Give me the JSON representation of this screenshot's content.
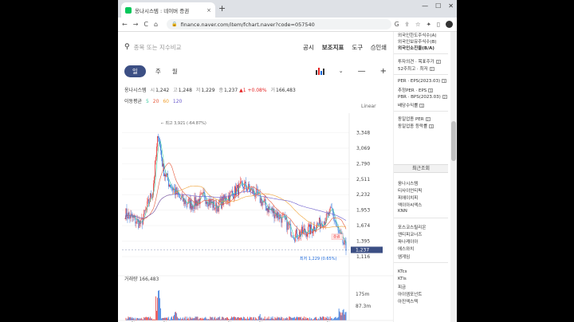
{
  "browser": {
    "tab_title": "옹나시스템 : 네이버 증권",
    "tab_close": "×",
    "new_tab": "+",
    "window_controls": [
      "—",
      "☐",
      "✕"
    ],
    "url": "finance.naver.com/item/fchart.naver?code=057540",
    "nav": [
      "←",
      "→",
      "C",
      "⌂"
    ],
    "ext_icons": [
      "G",
      "⇪",
      "☆",
      "✦",
      "▯"
    ]
  },
  "toolbar": {
    "search_placeholder": "종목 또는 지수비교",
    "menu": [
      "공시",
      "보조지표",
      "도구"
    ],
    "print": "인쇄"
  },
  "period": {
    "active": "일",
    "items": [
      "주",
      "월"
    ],
    "minus": "—",
    "plus": "+"
  },
  "info": {
    "name": "옹나시스템",
    "open_label": "시",
    "open": "1,242",
    "high_label": "고",
    "high": "1,248",
    "low_label": "저",
    "low": "1,229",
    "close_label": "종",
    "close": "1,237",
    "change": "▲1",
    "change_pct": "+0.08%",
    "vol_label": "거",
    "volume": "166,483"
  },
  "ma": {
    "label": "이동평균",
    "periods": [
      "5",
      "20",
      "60",
      "120"
    ]
  },
  "colors": {
    "up": "#e52222",
    "down": "#1a66d9",
    "ma5": "#37c9a0",
    "ma20": "#e65a3c",
    "ma60": "#f0a030",
    "ma120": "#6a5acd",
    "current": "#3c4f84"
  },
  "chart_data": {
    "type": "candlestick",
    "scale": "Linear",
    "y_ticks": [
      3348,
      3069,
      2790,
      2511,
      2232,
      1953,
      1674,
      1395,
      1116
    ],
    "ylim": [
      1000,
      3700
    ],
    "x_ticks": [
      "4월",
      "8월",
      "2022",
      "4월",
      "8월",
      "2023",
      "4월"
    ],
    "max_label": "최고 3,921 (-64.87%)",
    "min_label": "최저 1,229 (0.65%)",
    "current_label": "1,237",
    "volume_label": "거래량",
    "volume": "166,483",
    "volume_ticks": [
      "175m",
      "87.3m"
    ],
    "marker_text": "증권"
  },
  "sidebar": {
    "top_lines": [
      "외국인한도주식수(A)",
      "외국인보유주식수(B)",
      "외국인소진율(B/A)"
    ],
    "target_lines": [
      "투자의견 · 목표주가",
      "52주최고 · 최저"
    ],
    "ratio_lines": [
      "PER · EPS(2023.03)",
      "추정PER · EPS",
      "PBR · BPS(2023.03)",
      "배당수익률"
    ],
    "industry_lines": [
      "동일업종 PER",
      "동일업종 등락률"
    ],
    "recent_header": "최근조회",
    "recent_lines": [
      "옹나시스템",
      "티사이언티픽",
      "피에이치피",
      "엑이아씨엑스",
      "KNN",
      "포스코스틸리온",
      "엔티피코너즈",
      "파나케이아",
      "에스와치",
      "엠게임",
      "KTcs",
      "KTis",
      "피금",
      "아이엠포넌트",
      "아진엑스텍"
    ]
  }
}
